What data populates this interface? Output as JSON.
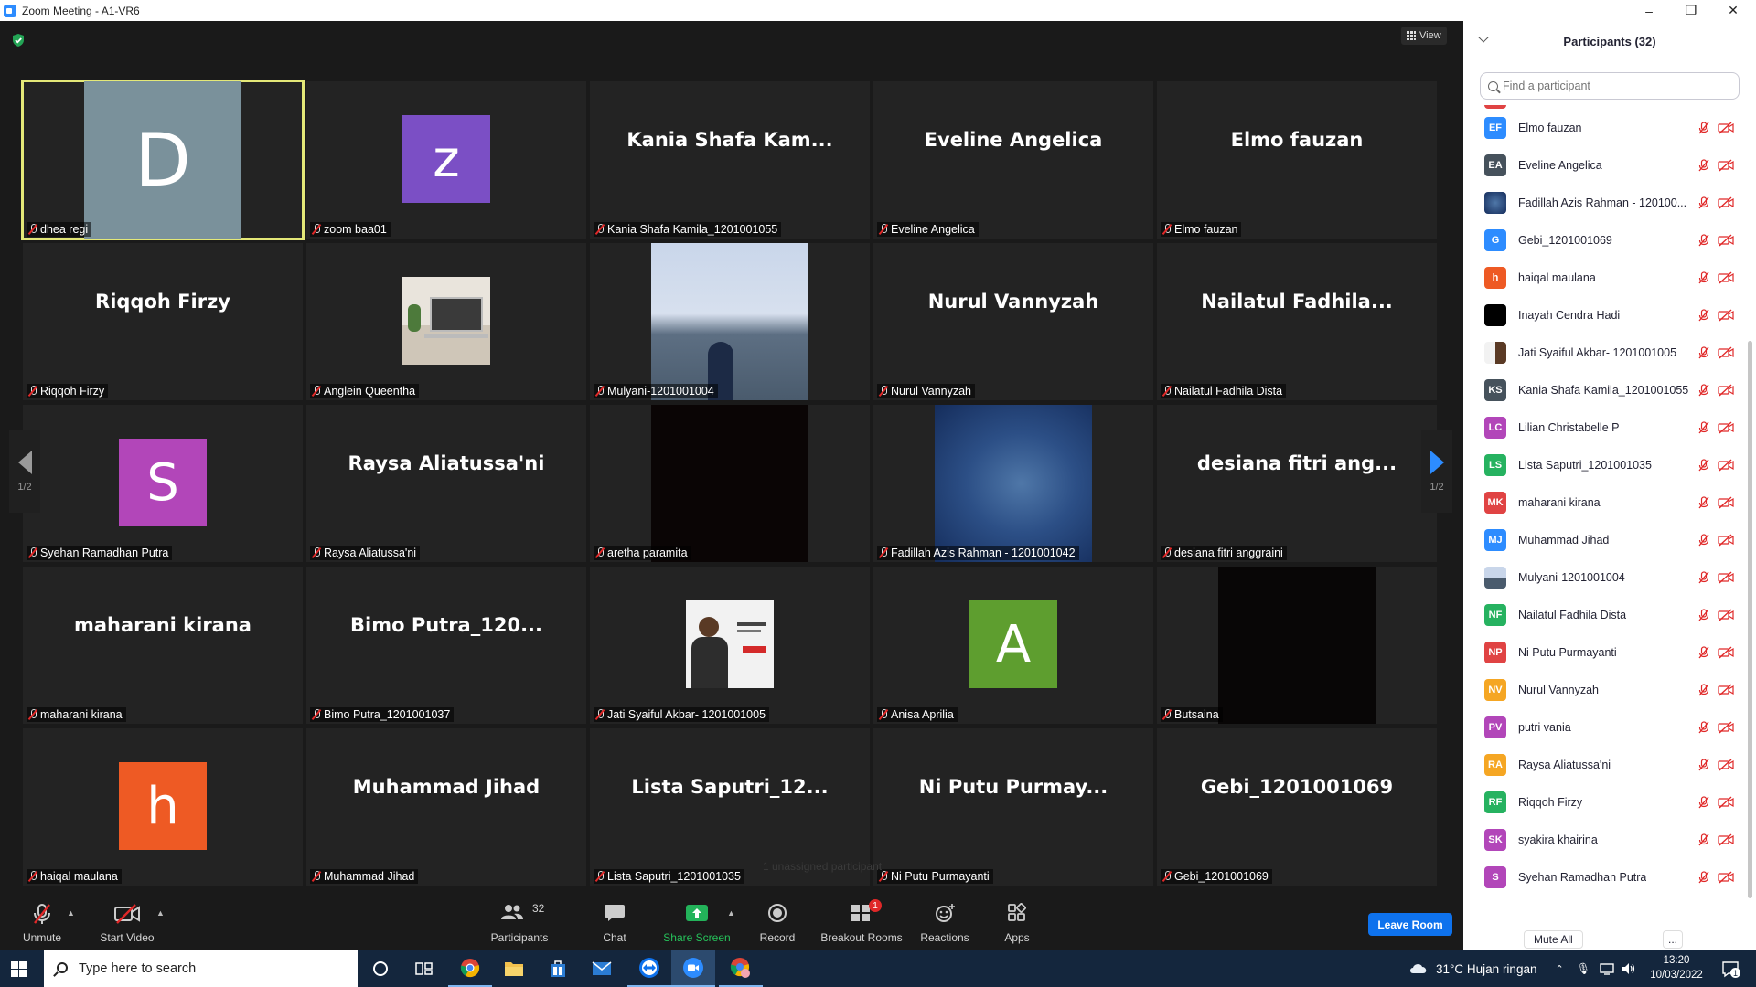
{
  "window": {
    "title": "Zoom Meeting - A1-VR6",
    "minimize": "–",
    "maximize": "❐",
    "close": "✕"
  },
  "view_button": {
    "label": "View"
  },
  "tiles": [
    {
      "display": "D",
      "kind": "avatar",
      "color": "#7a919b",
      "label": "dhea regi",
      "active": true
    },
    {
      "display": "z",
      "kind": "avatar",
      "color": "#7b4fc5",
      "label": "zoom baa01"
    },
    {
      "display": "Kania  Shafa  Kam...",
      "kind": "text",
      "label": "Kania Shafa Kamila_1201001055"
    },
    {
      "display": "Eveline Angelica",
      "kind": "text",
      "label": "Eveline Angelica"
    },
    {
      "display": "Elmo fauzan",
      "kind": "text",
      "label": "Elmo fauzan"
    },
    {
      "display": "Riqqoh Firzy",
      "kind": "text",
      "label": "Riqqoh Firzy"
    },
    {
      "display": "",
      "kind": "photo-laptop",
      "label": "Anglein Queentha"
    },
    {
      "display": "",
      "kind": "photo-sea",
      "label": "Mulyani-1201001004"
    },
    {
      "display": "Nurul Vannyzah",
      "kind": "text",
      "label": "Nurul Vannyzah"
    },
    {
      "display": "Nailatul  Fadhila...",
      "kind": "text",
      "label": "Nailatul Fadhila Dista"
    },
    {
      "display": "S",
      "kind": "avatar",
      "color": "#b246b9",
      "label": "Syehan Ramadhan Putra"
    },
    {
      "display": "Raysa Aliatussa'ni",
      "kind": "text",
      "label": "Raysa Aliatussa'ni"
    },
    {
      "display": "",
      "kind": "video-dark",
      "label": "aretha paramita"
    },
    {
      "display": "",
      "kind": "video-blue",
      "label": "Fadillah Azis Rahman - 1201001042"
    },
    {
      "display": "desiana fitri ang...",
      "kind": "text",
      "label": "desiana fitri anggraini"
    },
    {
      "display": "maharani kirana",
      "kind": "text",
      "label": "maharani kirana"
    },
    {
      "display": "Bimo  Putra_120...",
      "kind": "text",
      "label": "Bimo Putra_1201001037"
    },
    {
      "display": "",
      "kind": "photo-person",
      "label": "Jati Syaiful Akbar- 1201001005"
    },
    {
      "display": "A",
      "kind": "avatar",
      "color": "#5e9e2f",
      "label": "Anisa Aprilia"
    },
    {
      "display": "",
      "kind": "video-black",
      "label": "Butsaina"
    },
    {
      "display": "h",
      "kind": "avatar",
      "color": "#ee5a24",
      "label": "haiqal maulana"
    },
    {
      "display": "Muhammad Jihad",
      "kind": "text",
      "label": "Muhammad Jihad"
    },
    {
      "display": "Lista  Saputri_12...",
      "kind": "text",
      "label": "Lista Saputri_1201001035"
    },
    {
      "display": "Ni Putu  Purmay...",
      "kind": "text",
      "label": "Ni Putu Purmayanti"
    },
    {
      "display": "Gebi_1201001069",
      "kind": "text",
      "label": "Gebi_1201001069"
    }
  ],
  "pagination": {
    "left_page": "1/2",
    "right_page": "1/2"
  },
  "unassigned_text": "1 unassigned participant",
  "toolbar": {
    "unmute": "Unmute",
    "start_video": "Start Video",
    "participants": "Participants",
    "participants_count": "32",
    "chat": "Chat",
    "share_screen": "Share Screen",
    "record": "Record",
    "breakout_rooms": "Breakout Rooms",
    "breakout_badge": "1",
    "reactions": "Reactions",
    "apps": "Apps",
    "leave_room": "Leave Room"
  },
  "panel": {
    "title": "Participants (32)",
    "search_placeholder": "Find a participant",
    "mute_all": "Mute All",
    "more": "...",
    "participants": [
      {
        "initials": "EF",
        "color": "#2d8cff",
        "name": "Elmo fauzan"
      },
      {
        "initials": "EA",
        "color": "#46525c",
        "name": "Eveline Angelica"
      },
      {
        "initials": "",
        "color": "#2a4f8c",
        "name": "Fadillah Azis Rahman - 120100..."
      },
      {
        "initials": "G",
        "color": "#2d8cff",
        "name": "Gebi_1201001069"
      },
      {
        "initials": "h",
        "color": "#ee5a24",
        "name": "haiqal maulana"
      },
      {
        "initials": "",
        "color": "#000000",
        "name": "Inayah Cendra Hadi"
      },
      {
        "initials": "",
        "color": "#e8e4dc",
        "name": "Jati Syaiful Akbar- 1201001005"
      },
      {
        "initials": "KS",
        "color": "#46525c",
        "name": "Kania Shafa Kamila_1201001055"
      },
      {
        "initials": "LC",
        "color": "#b246b9",
        "name": "Lilian Christabelle P"
      },
      {
        "initials": "LS",
        "color": "#26b260",
        "name": "Lista Saputri_1201001035"
      },
      {
        "initials": "MK",
        "color": "#e04343",
        "name": "maharani kirana"
      },
      {
        "initials": "MJ",
        "color": "#2d8cff",
        "name": "Muhammad Jihad"
      },
      {
        "initials": "",
        "color": "#a9bcd8",
        "name": "Mulyani-1201001004"
      },
      {
        "initials": "NF",
        "color": "#26b260",
        "name": "Nailatul Fadhila Dista"
      },
      {
        "initials": "NP",
        "color": "#e04343",
        "name": "Ni Putu Purmayanti"
      },
      {
        "initials": "NV",
        "color": "#f5a623",
        "name": "Nurul Vannyzah"
      },
      {
        "initials": "PV",
        "color": "#b246b9",
        "name": "putri vania"
      },
      {
        "initials": "RA",
        "color": "#f5a623",
        "name": "Raysa Aliatussa'ni"
      },
      {
        "initials": "RF",
        "color": "#26b260",
        "name": "Riqqoh Firzy"
      },
      {
        "initials": "SK",
        "color": "#b246b9",
        "name": "syakira khairina"
      },
      {
        "initials": "S",
        "color": "#b246b9",
        "name": "Syehan Ramadhan Putra"
      }
    ]
  },
  "taskbar": {
    "search_placeholder": "Type here to search",
    "weather": "31°C  Hujan ringan",
    "time": "13:20",
    "date": "10/03/2022",
    "notification_count": "1"
  }
}
